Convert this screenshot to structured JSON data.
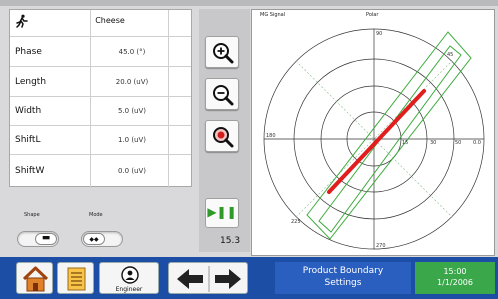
{
  "topbar": {
    "label": ""
  },
  "params": {
    "header_label": "Cheese",
    "rows": [
      {
        "label": "Phase",
        "value": "45.0 (°)"
      },
      {
        "label": "Length",
        "value": "20.0 (uV)"
      },
      {
        "label": "Width",
        "value": "5.0 (uV)"
      },
      {
        "label": "ShiftL",
        "value": "1.0 (uV)"
      },
      {
        "label": "ShiftW",
        "value": "0.0 (uV)"
      }
    ]
  },
  "toggles": {
    "shape_label": "Shape",
    "mode_label": "Mode",
    "shape_symbol": "▬",
    "mode_symbol": "◆◆"
  },
  "zoom": {
    "level": "15.3",
    "play_label": "▶❚❚"
  },
  "plot": {
    "signal_label": "MG Signal",
    "mode_label": "Polar",
    "tick_labels": {
      "top": "90",
      "left": "180",
      "right": "0.0",
      "bottom": "270",
      "ring_right_1": "15",
      "ring_right_2": "30",
      "ring_right_3": "50",
      "diag_tr": "45",
      "diag_bl": "225"
    }
  },
  "bottom": {
    "engineer_label": "Engineer",
    "screen_title_line1": "Product Boundary",
    "screen_title_line2": "Settings",
    "time": "15:00",
    "date": "1/1/2006"
  },
  "colors": {
    "bar": "#1d4ea6",
    "title_box": "#2a5fc0",
    "time_box": "#3aa84a",
    "signal": "#e11d1d",
    "boundary": "#3cab3c"
  }
}
